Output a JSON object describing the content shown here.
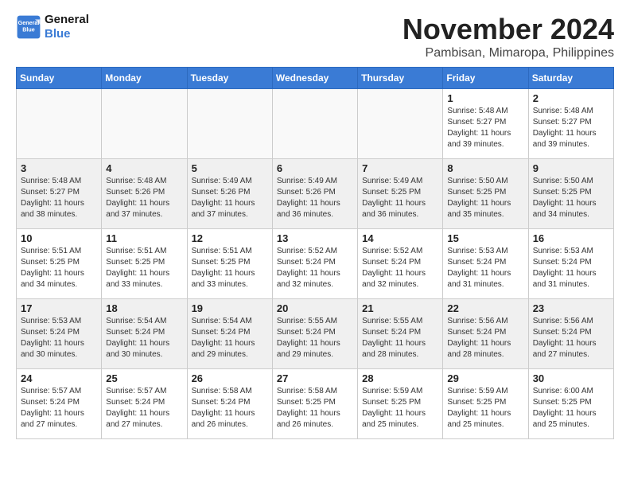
{
  "logo": {
    "line1": "General",
    "line2": "Blue"
  },
  "title": "November 2024",
  "location": "Pambisan, Mimaropa, Philippines",
  "headers": [
    "Sunday",
    "Monday",
    "Tuesday",
    "Wednesday",
    "Thursday",
    "Friday",
    "Saturday"
  ],
  "weeks": [
    [
      {
        "day": "",
        "info": ""
      },
      {
        "day": "",
        "info": ""
      },
      {
        "day": "",
        "info": ""
      },
      {
        "day": "",
        "info": ""
      },
      {
        "day": "",
        "info": ""
      },
      {
        "day": "1",
        "info": "Sunrise: 5:48 AM\nSunset: 5:27 PM\nDaylight: 11 hours\nand 39 minutes."
      },
      {
        "day": "2",
        "info": "Sunrise: 5:48 AM\nSunset: 5:27 PM\nDaylight: 11 hours\nand 39 minutes."
      }
    ],
    [
      {
        "day": "3",
        "info": "Sunrise: 5:48 AM\nSunset: 5:27 PM\nDaylight: 11 hours\nand 38 minutes."
      },
      {
        "day": "4",
        "info": "Sunrise: 5:48 AM\nSunset: 5:26 PM\nDaylight: 11 hours\nand 37 minutes."
      },
      {
        "day": "5",
        "info": "Sunrise: 5:49 AM\nSunset: 5:26 PM\nDaylight: 11 hours\nand 37 minutes."
      },
      {
        "day": "6",
        "info": "Sunrise: 5:49 AM\nSunset: 5:26 PM\nDaylight: 11 hours\nand 36 minutes."
      },
      {
        "day": "7",
        "info": "Sunrise: 5:49 AM\nSunset: 5:25 PM\nDaylight: 11 hours\nand 36 minutes."
      },
      {
        "day": "8",
        "info": "Sunrise: 5:50 AM\nSunset: 5:25 PM\nDaylight: 11 hours\nand 35 minutes."
      },
      {
        "day": "9",
        "info": "Sunrise: 5:50 AM\nSunset: 5:25 PM\nDaylight: 11 hours\nand 34 minutes."
      }
    ],
    [
      {
        "day": "10",
        "info": "Sunrise: 5:51 AM\nSunset: 5:25 PM\nDaylight: 11 hours\nand 34 minutes."
      },
      {
        "day": "11",
        "info": "Sunrise: 5:51 AM\nSunset: 5:25 PM\nDaylight: 11 hours\nand 33 minutes."
      },
      {
        "day": "12",
        "info": "Sunrise: 5:51 AM\nSunset: 5:25 PM\nDaylight: 11 hours\nand 33 minutes."
      },
      {
        "day": "13",
        "info": "Sunrise: 5:52 AM\nSunset: 5:24 PM\nDaylight: 11 hours\nand 32 minutes."
      },
      {
        "day": "14",
        "info": "Sunrise: 5:52 AM\nSunset: 5:24 PM\nDaylight: 11 hours\nand 32 minutes."
      },
      {
        "day": "15",
        "info": "Sunrise: 5:53 AM\nSunset: 5:24 PM\nDaylight: 11 hours\nand 31 minutes."
      },
      {
        "day": "16",
        "info": "Sunrise: 5:53 AM\nSunset: 5:24 PM\nDaylight: 11 hours\nand 31 minutes."
      }
    ],
    [
      {
        "day": "17",
        "info": "Sunrise: 5:53 AM\nSunset: 5:24 PM\nDaylight: 11 hours\nand 30 minutes."
      },
      {
        "day": "18",
        "info": "Sunrise: 5:54 AM\nSunset: 5:24 PM\nDaylight: 11 hours\nand 30 minutes."
      },
      {
        "day": "19",
        "info": "Sunrise: 5:54 AM\nSunset: 5:24 PM\nDaylight: 11 hours\nand 29 minutes."
      },
      {
        "day": "20",
        "info": "Sunrise: 5:55 AM\nSunset: 5:24 PM\nDaylight: 11 hours\nand 29 minutes."
      },
      {
        "day": "21",
        "info": "Sunrise: 5:55 AM\nSunset: 5:24 PM\nDaylight: 11 hours\nand 28 minutes."
      },
      {
        "day": "22",
        "info": "Sunrise: 5:56 AM\nSunset: 5:24 PM\nDaylight: 11 hours\nand 28 minutes."
      },
      {
        "day": "23",
        "info": "Sunrise: 5:56 AM\nSunset: 5:24 PM\nDaylight: 11 hours\nand 27 minutes."
      }
    ],
    [
      {
        "day": "24",
        "info": "Sunrise: 5:57 AM\nSunset: 5:24 PM\nDaylight: 11 hours\nand 27 minutes."
      },
      {
        "day": "25",
        "info": "Sunrise: 5:57 AM\nSunset: 5:24 PM\nDaylight: 11 hours\nand 27 minutes."
      },
      {
        "day": "26",
        "info": "Sunrise: 5:58 AM\nSunset: 5:24 PM\nDaylight: 11 hours\nand 26 minutes."
      },
      {
        "day": "27",
        "info": "Sunrise: 5:58 AM\nSunset: 5:25 PM\nDaylight: 11 hours\nand 26 minutes."
      },
      {
        "day": "28",
        "info": "Sunrise: 5:59 AM\nSunset: 5:25 PM\nDaylight: 11 hours\nand 25 minutes."
      },
      {
        "day": "29",
        "info": "Sunrise: 5:59 AM\nSunset: 5:25 PM\nDaylight: 11 hours\nand 25 minutes."
      },
      {
        "day": "30",
        "info": "Sunrise: 6:00 AM\nSunset: 5:25 PM\nDaylight: 11 hours\nand 25 minutes."
      }
    ]
  ]
}
